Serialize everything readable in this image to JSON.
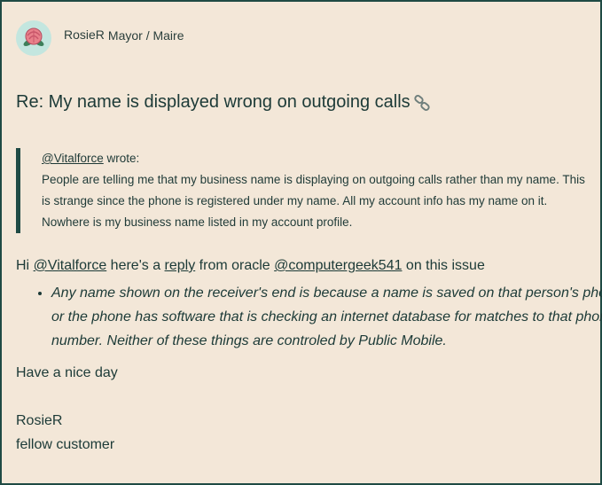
{
  "author": {
    "name": "RosieR",
    "rank": "Mayor / Maire",
    "avatar_icon": "rose-icon"
  },
  "post": {
    "subject": "Re: My name is displayed wrong on outgoing calls",
    "subject_icon": "link-icon",
    "quote": {
      "mention": "@Vitalforce",
      "wrote": " wrote:",
      "body": "People are telling me that my business name is displaying on outgoing calls rather than my name. This is strange since the phone is registered under my name. All my account info has my name on it. Nowhere is my business name listed in my account profile."
    },
    "reply": {
      "hi": "Hi ",
      "mention": "@Vitalforce",
      "heres": " here's a ",
      "reply_link": "reply",
      "from": " from oracle ",
      "oracle_mention": "@computergeek541",
      "tail": " on this issue"
    },
    "bullets": [
      " Any name shown on the receiver's end is because a name is saved on that person's phone or the phone has software that is checking an internet database for matches to that phone number. Neither of these things are controled by Public Mobile."
    ],
    "closing": "Have a nice day",
    "signature_name": "RosieR",
    "signature_title": "fellow customer"
  },
  "colors": {
    "background": "#f3e7d8",
    "text": "#1c3a37",
    "border": "#1f4a44",
    "avatar_bg": "#c3e6df",
    "rose": "#e8808a"
  }
}
